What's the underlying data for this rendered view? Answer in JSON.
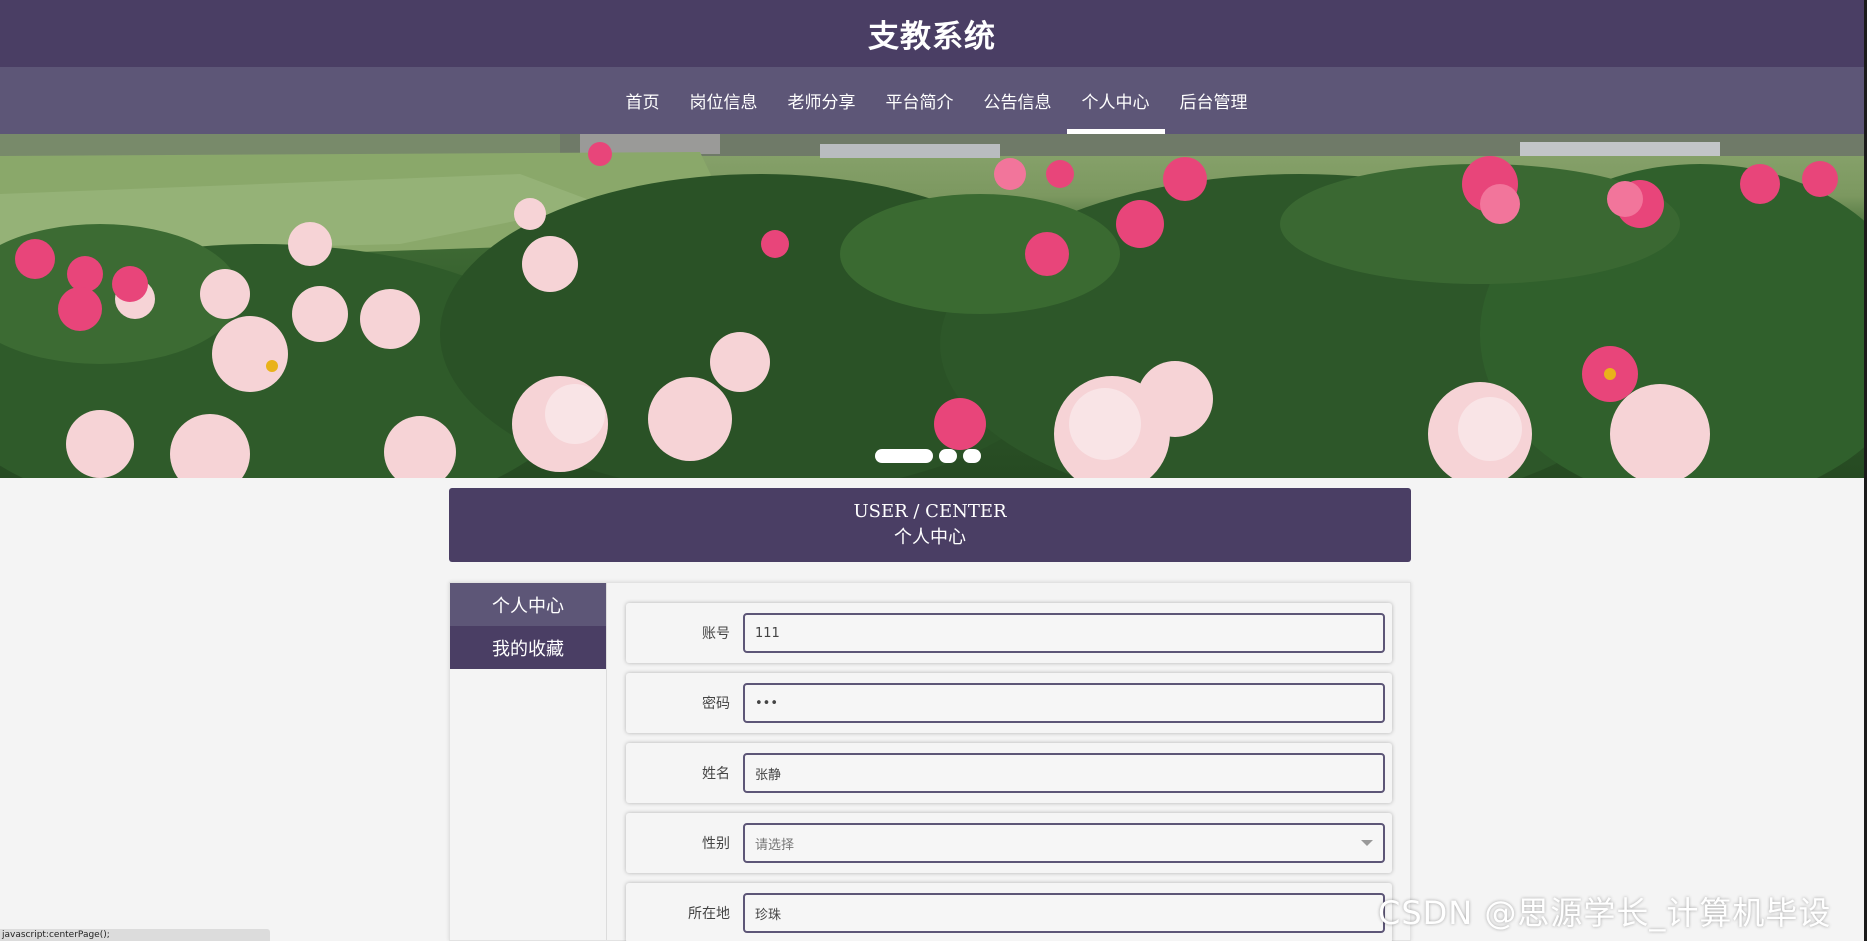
{
  "site": {
    "title": "支教系统"
  },
  "nav": {
    "items": [
      {
        "label": "首页"
      },
      {
        "label": "岗位信息"
      },
      {
        "label": "老师分享"
      },
      {
        "label": "平台简介"
      },
      {
        "label": "公告信息"
      },
      {
        "label": "个人中心",
        "active": true
      },
      {
        "label": "后台管理"
      }
    ]
  },
  "banner": {
    "slides_count": 3,
    "active_slide": 1
  },
  "section": {
    "title_en": "USER / CENTER",
    "title_cn": "个人中心"
  },
  "sidebar": {
    "items": [
      {
        "label": "个人中心"
      },
      {
        "label": "我的收藏"
      }
    ]
  },
  "form": {
    "fields": [
      {
        "label": "账号",
        "value": "111"
      },
      {
        "label": "密码",
        "value": "•••"
      },
      {
        "label": "姓名",
        "value": "张静"
      },
      {
        "label": "性别",
        "value": "请选择"
      },
      {
        "label": "所在地",
        "value": "珍珠"
      }
    ]
  },
  "watermark": "CSDN @思源学长_计算机毕设",
  "status_bar": "javascript:centerPage();",
  "colors": {
    "header": "#4a3e64",
    "nav": "#5d5677",
    "accent_border": "#5d5677",
    "page_bg": "#f4f4f4"
  }
}
